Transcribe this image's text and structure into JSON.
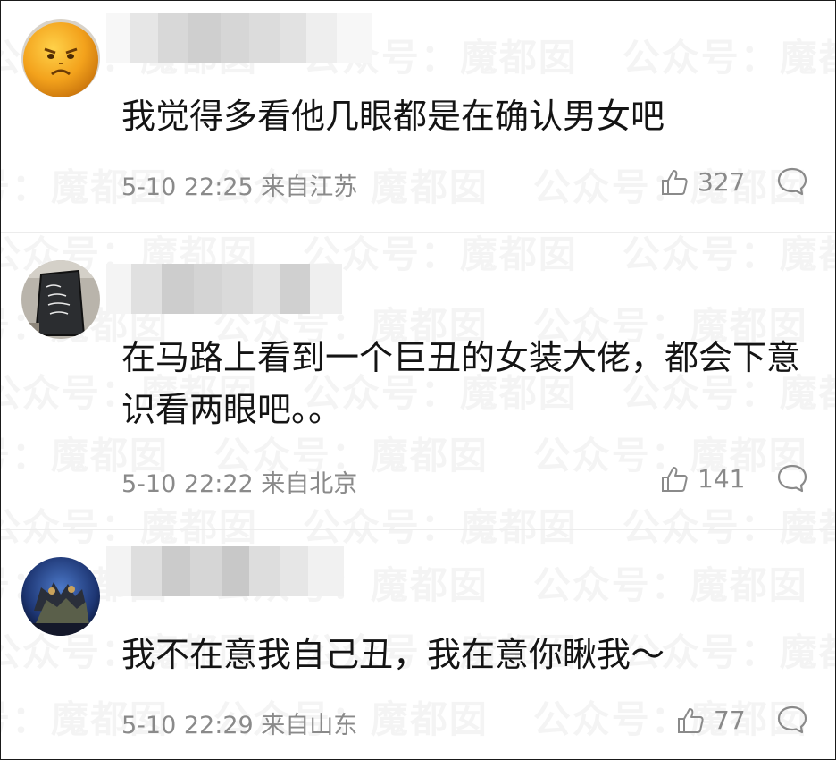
{
  "watermark": "公众号：魔都囡",
  "comments": [
    {
      "username": "",
      "avatar": "orange-face",
      "content": "我觉得多看他几眼都是在确认男女吧",
      "time": "5-10 22:25",
      "location": "来自江苏",
      "likes": "327"
    },
    {
      "username": "",
      "avatar": "chalkboard",
      "content": "在马路上看到一个巨丑的女装大佬，都会下意识看两眼吧。。",
      "time": "5-10 22:22",
      "location": "来自北京",
      "likes": "141"
    },
    {
      "username": "",
      "avatar": "blue-scene",
      "content": "我不在意我自己丑，我在意你瞅我～",
      "time": "5-10 22:29",
      "location": "来自山东",
      "likes": "77"
    }
  ],
  "colors": {
    "text": "#141414",
    "meta": "#8a8a8a",
    "divider": "#ececec"
  }
}
